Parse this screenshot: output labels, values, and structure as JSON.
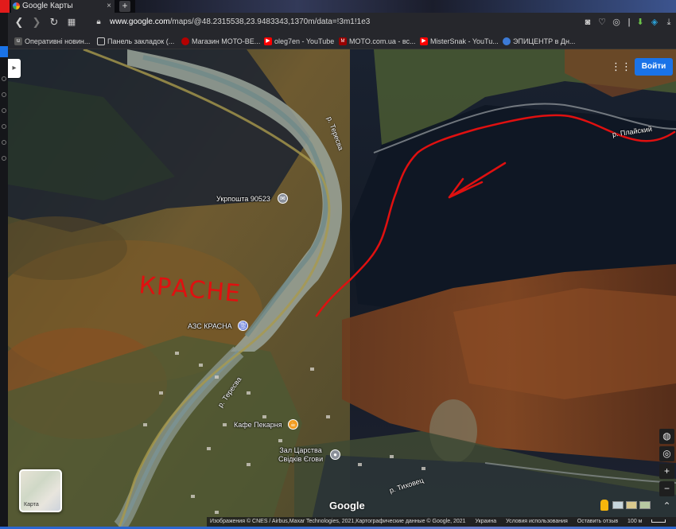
{
  "browser": {
    "tab_title": "Google Карты",
    "new_tab_symbol": "+",
    "url_host": "www.google.com",
    "url_path": "/maps/@48.2315538,23.9483343,1370m/data=!3m1!1e3",
    "bookmarks": [
      {
        "label": "Оперативні новин...",
        "icon": "news-icon"
      },
      {
        "label": "Панель закладок (...",
        "icon": "folder-icon"
      },
      {
        "label": "Магазин МОТО-ВЕ...",
        "icon": "moto-shop-icon"
      },
      {
        "label": "oleg7en - YouTube",
        "icon": "youtube-icon"
      },
      {
        "label": "MOTO.com.ua - вс...",
        "icon": "moto-site-icon"
      },
      {
        "label": "MisterSnak - YouTu...",
        "icon": "youtube-icon"
      },
      {
        "label": "ЭПИЦЕНТР в Дн...",
        "icon": "epicentr-icon"
      }
    ]
  },
  "map": {
    "signin_label": "Войти",
    "places": {
      "post_office": "Укрпошта 90523",
      "gas_station": "АЗС КРАСНА",
      "cafe": "Кафе Пекарня",
      "kingdom_hall_line1": "Зал Царства",
      "kingdom_hall_line2": "Свідків Єгови"
    },
    "rivers": {
      "teresva_north": "р. Тересва",
      "teresva_south": "р. Тересва",
      "plaiskyi": "р. Плайский",
      "tykhovets": "р. Тиховец"
    },
    "handwritten_annotation": "КРАСНЕ",
    "layers_label": "Карта",
    "google_logo": "Google",
    "attribution": {
      "imagery": "Изображения © CNES / Airbus,Maxar Technologies, 2021,Картографические данные © Google, 2021",
      "country": "Украина",
      "terms": "Условия использования",
      "feedback": "Оставить отзыв",
      "scale": "100 м"
    },
    "colors": {
      "annotation_red": "#e01010",
      "signin_blue": "#1a73e8",
      "pin_blue": "#6a7fdc",
      "pin_orange": "#f29c1f",
      "pin_gray": "#8a8f99"
    }
  }
}
